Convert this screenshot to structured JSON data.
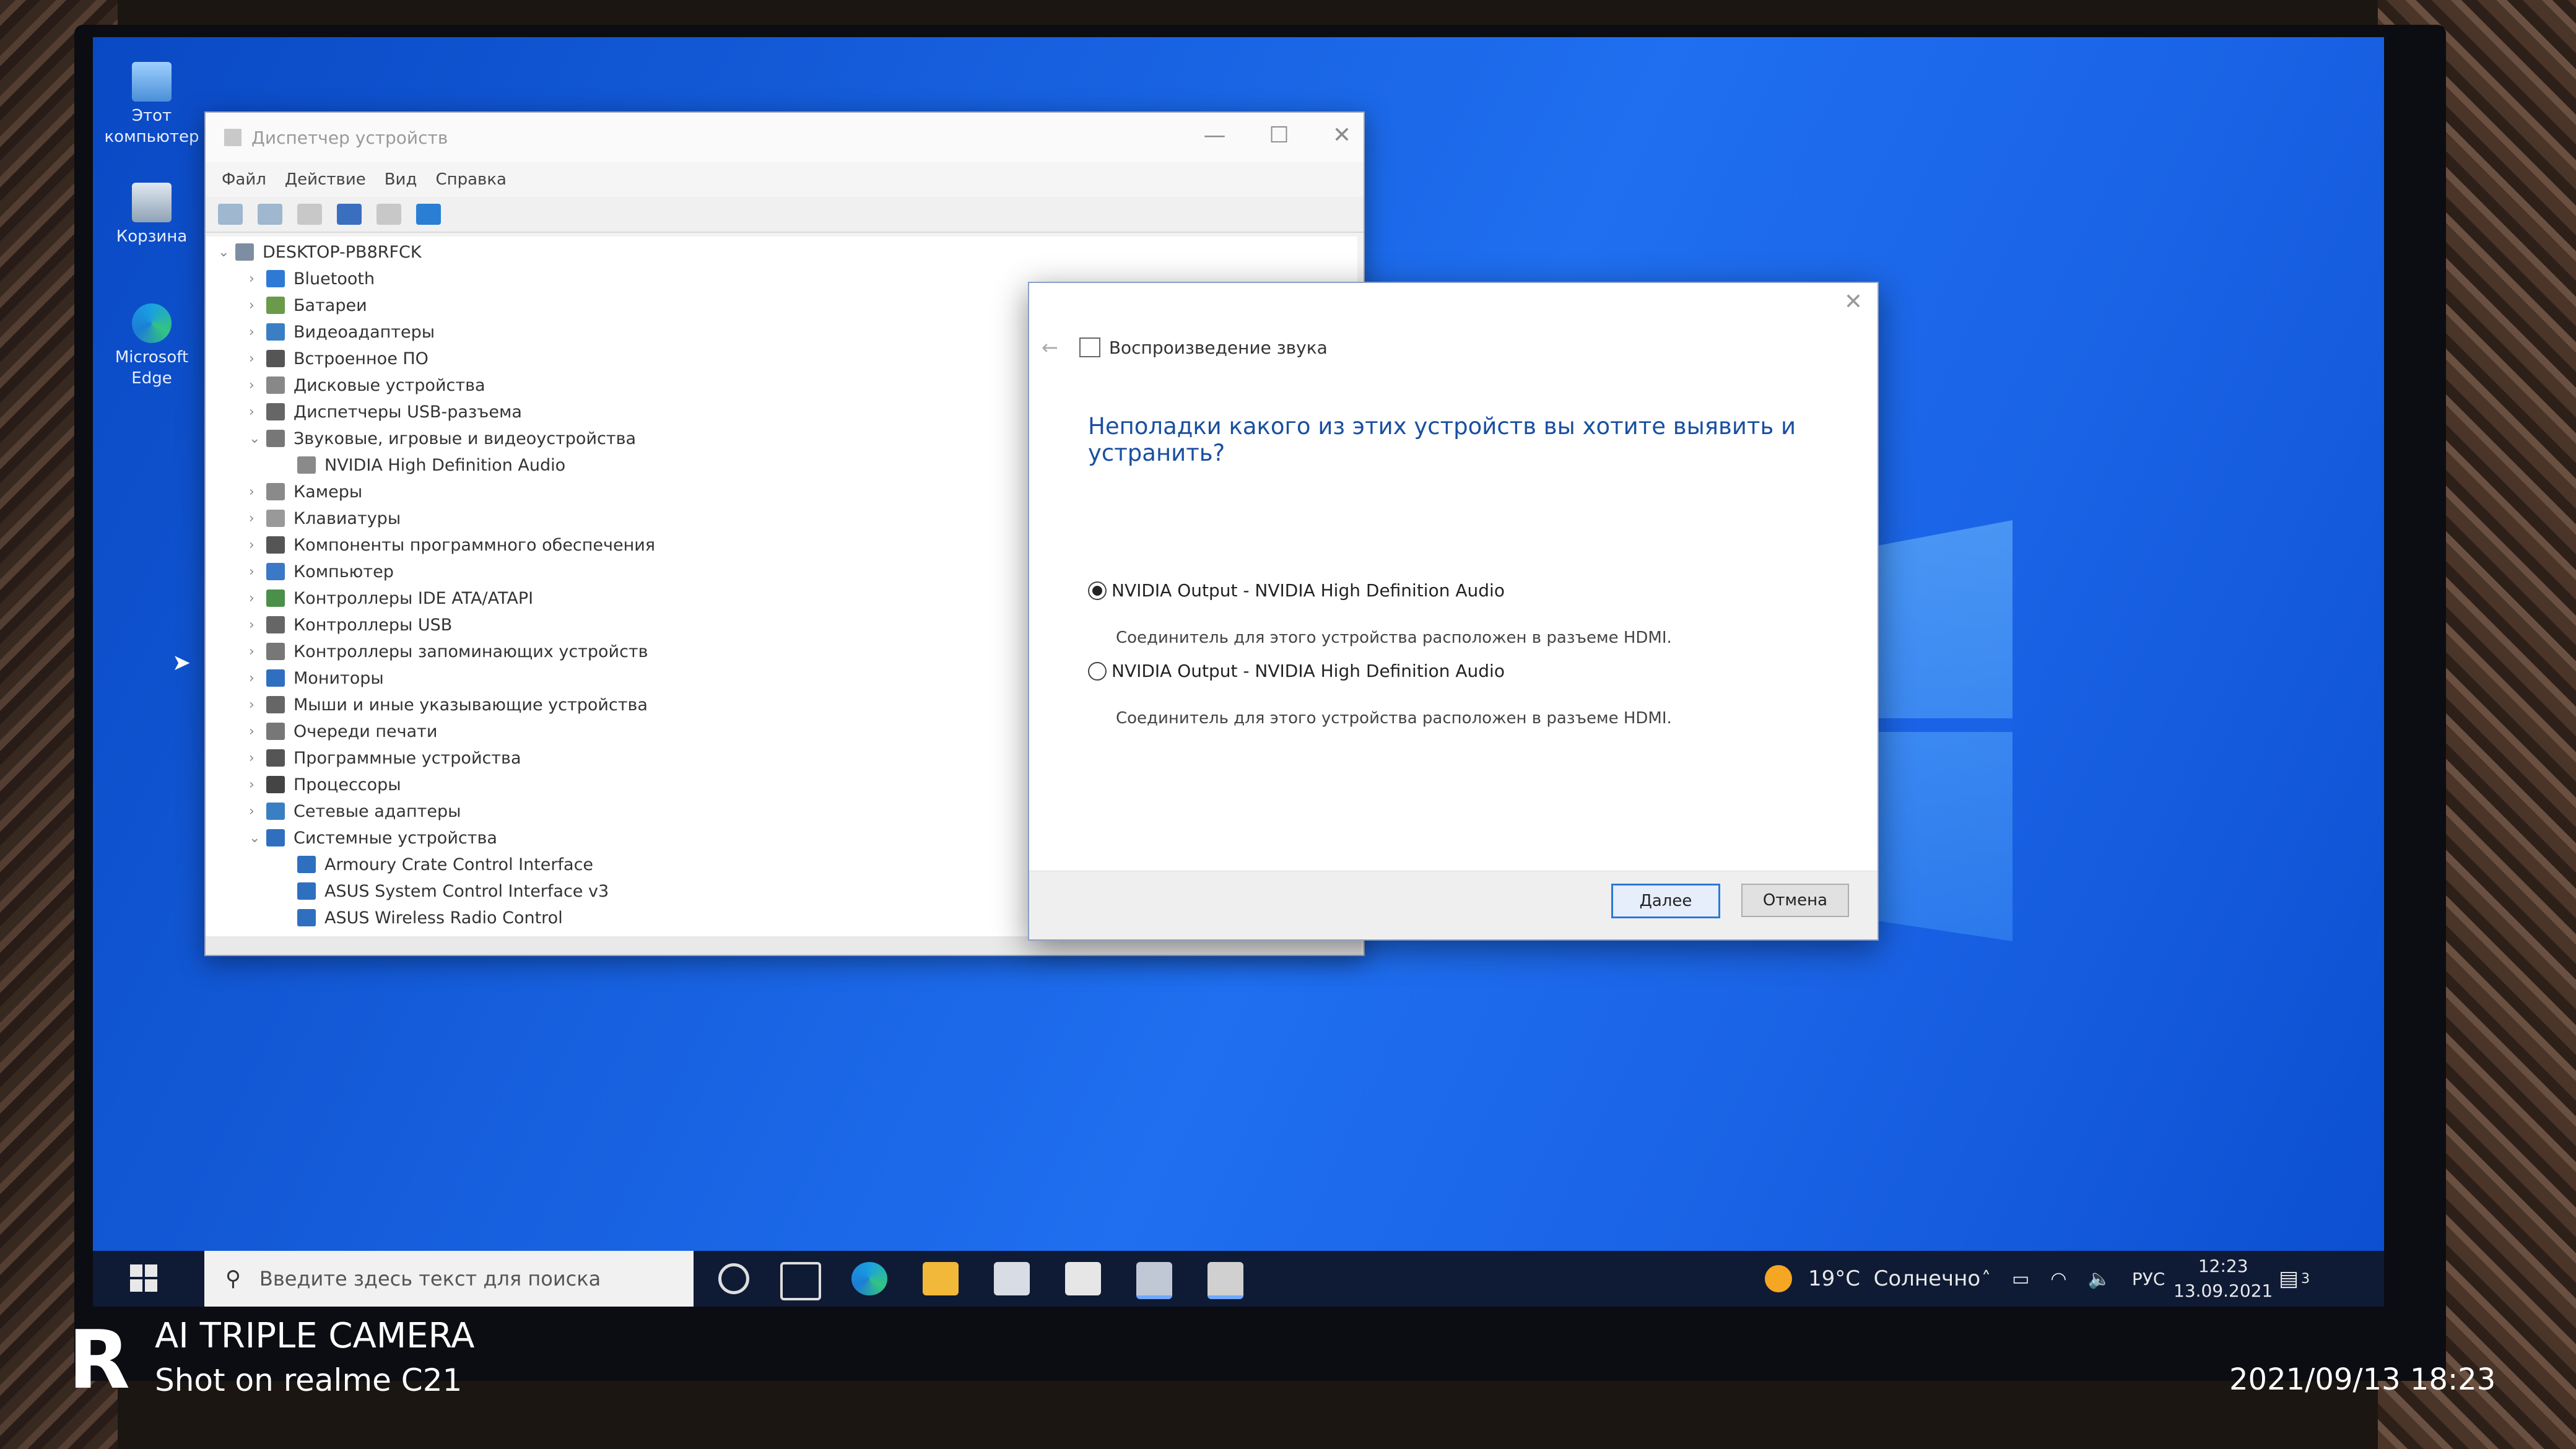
{
  "desktop": {
    "icons": [
      {
        "label": "Этот\nкомпьютер"
      },
      {
        "label": "Корзина"
      },
      {
        "label": "Microsoft\nEdge"
      }
    ]
  },
  "devmgr": {
    "title": "Диспетчер устройств",
    "menu": [
      "Файл",
      "Действие",
      "Вид",
      "Справка"
    ],
    "tree": [
      {
        "label": "DESKTOP-PB8RFCK",
        "level": 0,
        "expanded": true
      },
      {
        "label": "Bluetooth",
        "level": 1
      },
      {
        "label": "Батареи",
        "level": 1
      },
      {
        "label": "Видеоадаптеры",
        "level": 1
      },
      {
        "label": "Встроенное ПО",
        "level": 1
      },
      {
        "label": "Дисковые устройства",
        "level": 1
      },
      {
        "label": "Диспетчеры USB-разъема",
        "level": 1
      },
      {
        "label": "Звуковые, игровые и видеоустройства",
        "level": 1,
        "expanded": true
      },
      {
        "label": "NVIDIA High Definition Audio",
        "level": 2
      },
      {
        "label": "Камеры",
        "level": 1
      },
      {
        "label": "Клавиатуры",
        "level": 1
      },
      {
        "label": "Компоненты программного обеспечения",
        "level": 1
      },
      {
        "label": "Компьютер",
        "level": 1
      },
      {
        "label": "Контроллеры IDE ATA/ATAPI",
        "level": 1
      },
      {
        "label": "Контроллеры USB",
        "level": 1
      },
      {
        "label": "Контроллеры запоминающих устройств",
        "level": 1
      },
      {
        "label": "Мониторы",
        "level": 1
      },
      {
        "label": "Мыши и иные указывающие устройства",
        "level": 1
      },
      {
        "label": "Очереди печати",
        "level": 1
      },
      {
        "label": "Программные устройства",
        "level": 1
      },
      {
        "label": "Процессоры",
        "level": 1
      },
      {
        "label": "Сетевые адаптеры",
        "level": 1
      },
      {
        "label": "Системные устройства",
        "level": 1,
        "expanded": true
      },
      {
        "label": "Armoury Crate Control Interface",
        "level": 2
      },
      {
        "label": "ASUS System Control Interface v3",
        "level": 2
      },
      {
        "label": "ASUS Wireless Radio Control",
        "level": 2
      }
    ]
  },
  "dialog": {
    "header": "Воспроизведение звука",
    "question": "Неполадки какого из этих устройств вы хотите выявить и устранить?",
    "options": [
      {
        "label": "NVIDIA Output - NVIDIA High Definition Audio",
        "desc": "Соединитель для этого устройства расположен в разъеме HDMI.",
        "selected": true
      },
      {
        "label": "NVIDIA Output - NVIDIA High Definition Audio",
        "desc": "Соединитель для этого устройства расположен в разъеме HDMI.",
        "selected": false
      }
    ],
    "next_label": "Далее",
    "cancel_label": "Отмена"
  },
  "taskbar": {
    "search_placeholder": "Введите здесь текст для поиска",
    "weather": "19°C  Солнечно",
    "language": "РУС",
    "time": "12:23",
    "date": "13.09.2021",
    "notification_count": "3"
  },
  "photo_caption": {
    "camera": "AI TRIPLE CAMERA",
    "device": "Shot on realme C21",
    "timestamp": "2021/09/13 18:23"
  }
}
